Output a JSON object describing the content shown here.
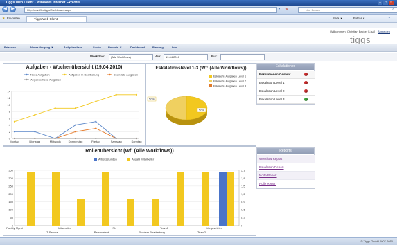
{
  "browser": {
    "title": "Tiggs Web Client - Windows Internet Explorer",
    "address": "http://devrt9n/tiggs/Dashboard.aspx",
    "search_placeholder": "Live Search",
    "favorites_label": "Favoriten",
    "tab_label": "Tiggs Web Client",
    "tools": [
      "Seite ▾",
      "Extras ▾"
    ]
  },
  "app": {
    "welcome": "Willkommen, Christian Becker [Lisa]",
    "logout": "Abmelden",
    "logo": "tiggs",
    "menu": [
      "Erfassen",
      "Neuer Vorgang ▼",
      "Aufgabenliste",
      "Suche",
      "Reports ▼",
      "Dashboard",
      "Planung",
      "Info"
    ],
    "filters": {
      "workflow_label": "Workflow:",
      "workflow_value": "(Alle Workflows)",
      "von_label": "Von:",
      "von_value": "19.04.2010",
      "bis_label": "Bis:",
      "bis_value": ""
    },
    "copyright": "© Tiggs GmbH 2007-2010"
  },
  "escalations": {
    "header": "Eskalationen",
    "rows": [
      {
        "label": "Eskalationen Gesamt",
        "status": "red",
        "bold": true
      },
      {
        "label": "Eskalation Level 1",
        "status": "red",
        "bold": false
      },
      {
        "label": "Eskalation Level 2",
        "status": "red",
        "bold": false
      },
      {
        "label": "Eskalation Level 3",
        "status": "green",
        "bold": false
      }
    ]
  },
  "reports": {
    "header": "Reports",
    "links": [
      "Workflow Report",
      "Eskalation Report",
      "Node Report",
      "Rolle Report"
    ]
  },
  "colors": {
    "red": "#cc2b2b",
    "green": "#3aa53a",
    "yellow": "#f2c81f",
    "blue": "#4a74c9"
  },
  "chart_data": [
    {
      "type": "line",
      "title": "Aufgaben - Wochenübersicht (19.04.2010)",
      "categories": [
        "Montag",
        "Dienstag",
        "Mittwoch",
        "Donnerstag",
        "Freitag",
        "Samstag",
        "Sonntag"
      ],
      "ylim": [
        0,
        14
      ],
      "yticks": [
        "0",
        "2",
        "4",
        "6",
        "8",
        "10",
        "12",
        "14"
      ],
      "series": [
        {
          "name": "Neue Aufgaben",
          "color": "#5a86c8",
          "values": [
            2,
            2,
            0,
            4,
            5,
            0,
            0
          ]
        },
        {
          "name": "Aufgaben in Bearbeitung",
          "color": "#f2c81f",
          "values": [
            5,
            7,
            9,
            9,
            11,
            13,
            13
          ]
        },
        {
          "name": "Beendete Aufgaben",
          "color": "#e57a2a",
          "values": [
            0,
            0,
            0,
            2,
            3,
            0,
            0
          ]
        },
        {
          "name": "Abgebrochene Aufgaben",
          "color": "#9a9a9a",
          "values": [
            0,
            0,
            0,
            0,
            0,
            0,
            0
          ]
        }
      ]
    },
    {
      "type": "pie",
      "title": "Eskalationslevel 1-3 (Wf: (Alle Workflows))",
      "slices": [
        {
          "name": "Eskalierte Aufgaben Level 1",
          "value": 50,
          "label": "50%",
          "color": "#f2c81f"
        },
        {
          "name": "Eskalierte Aufgaben Level 2",
          "value": 50,
          "label": "50%",
          "color": "#f0d060"
        },
        {
          "name": "Eskalierte Aufgaben Level 3",
          "value": 0,
          "label": "",
          "color": "#e07a2a"
        }
      ]
    },
    {
      "type": "bar",
      "title": "Rollenübersicht (Wf: (Alle Workflows))",
      "categories": [
        "Facility Mgmt",
        "IT Service",
        "Mitarbeiter",
        "Personalabt.",
        "PL",
        "Problem Bearbeitung",
        "Team1",
        "Team2",
        "Vorgesetzter"
      ],
      "ylim": [
        0,
        350
      ],
      "yticks": [
        "0",
        "50",
        "100",
        "150",
        "200",
        "250",
        "300",
        "350"
      ],
      "y2ticks": [
        "0",
        "0,3",
        "0,6",
        "0,9",
        "1,2",
        "1,5",
        "1,8",
        "2,1"
      ],
      "series": [
        {
          "name": "Arbeitsstunden",
          "color": "#4a74c9",
          "values": [
            0,
            0,
            0,
            0,
            0,
            0,
            0,
            0,
            340
          ]
        },
        {
          "name": "Anzahl Mitarbeiter",
          "color": "#f2c81f",
          "values": [
            340,
            340,
            170,
            340,
            170,
            170,
            340,
            340,
            340
          ]
        }
      ]
    }
  ]
}
